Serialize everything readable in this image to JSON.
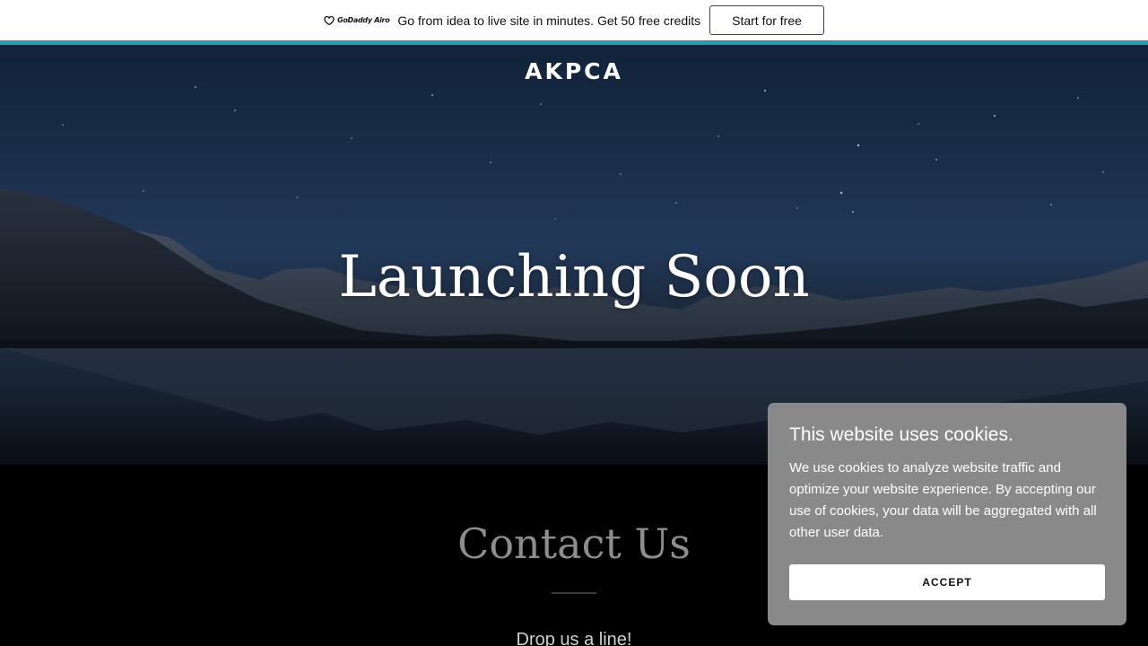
{
  "promo": {
    "brand": "GoDaddy Airo",
    "text": "Go from idea to live site in minutes. Get 50 free credits",
    "button_label": "Start for free"
  },
  "site": {
    "title": "AKPCA"
  },
  "hero": {
    "heading": "Launching Soon"
  },
  "contact": {
    "heading": "Contact Us",
    "subheading": "Drop us a line!"
  },
  "cookie_banner": {
    "title": "This website uses cookies.",
    "body": "We use cookies to analyze website traffic and optimize your website experience. By accepting our use of cookies, your data will be aggregated with all other user data.",
    "accept_label": "ACCEPT"
  },
  "colors": {
    "accent": "#1aa4a7",
    "cookie_background": "#898989",
    "contact_heading": "#8d8d8d"
  }
}
